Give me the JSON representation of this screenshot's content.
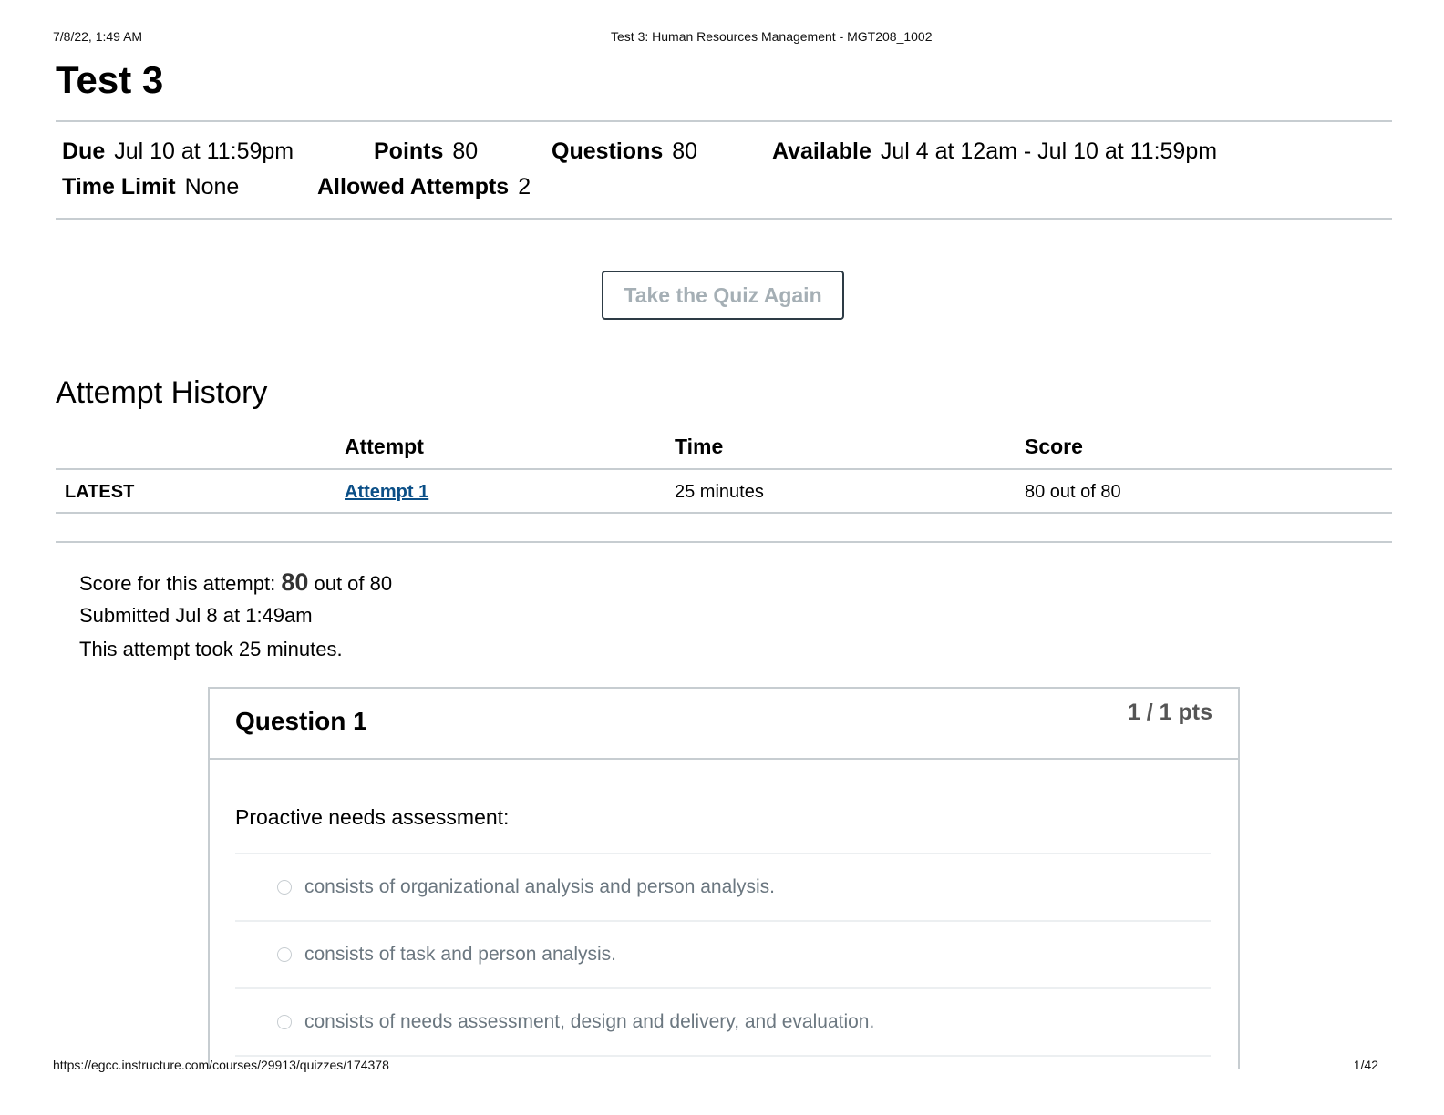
{
  "print_header": {
    "date": "7/8/22, 1:49 AM",
    "title": "Test 3: Human Resources Management - MGT208_1002"
  },
  "print_footer": {
    "url": "https://egcc.instructure.com/courses/29913/quizzes/174378",
    "page": "1/42"
  },
  "page_title": "Test 3",
  "meta": {
    "due_label": "Due",
    "due_value": "Jul 10 at 11:59pm",
    "points_label": "Points",
    "points_value": "80",
    "questions_label": "Questions",
    "questions_value": "80",
    "available_label": "Available",
    "available_value": "Jul 4 at 12am - Jul 10 at 11:59pm",
    "time_limit_label": "Time Limit",
    "time_limit_value": "None",
    "attempts_label": "Allowed Attempts",
    "attempts_value": "2"
  },
  "take_quiz_button": "Take the Quiz Again",
  "attempt_history": {
    "title": "Attempt History",
    "columns": [
      "",
      "Attempt",
      "Time",
      "Score"
    ],
    "rows": [
      {
        "tag": "LATEST",
        "attempt": "Attempt 1",
        "time": "25 minutes",
        "score": "80 out of 80"
      }
    ]
  },
  "summary": {
    "score_prefix": "Score for this attempt: ",
    "score_value": "80",
    "score_suffix": " out of 80",
    "submitted": "Submitted Jul 8 at 1:49am",
    "duration": "This attempt took 25 minutes."
  },
  "question": {
    "title": "Question 1",
    "points": "1 / 1 pts",
    "text": "Proactive needs assessment:",
    "answers": [
      "consists of organizational analysis and person analysis.",
      "consists of task and person analysis.",
      "consists of needs assessment, design and delivery, and evaluation."
    ]
  }
}
